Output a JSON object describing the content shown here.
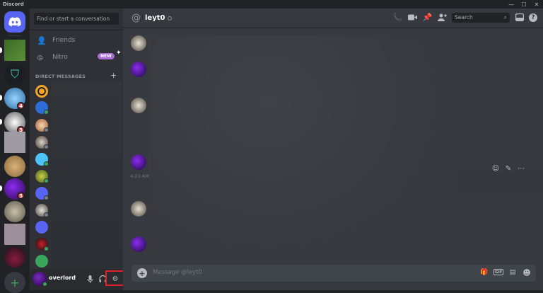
{
  "app": {
    "title": "Discord"
  },
  "window_controls": {
    "minimize": "—",
    "maximize": "☐",
    "close": "✕"
  },
  "guilds": {
    "badges": [
      "4",
      "3",
      "3"
    ],
    "add_glyph": "+"
  },
  "dm_sidebar": {
    "search_placeholder": "Find or start a conversation",
    "friends_label": "Friends",
    "nitro_label": "Nitro",
    "nitro_badge": "NEW",
    "direct_messages_header": "DIRECT MESSAGES",
    "add_dm_glyph": "+"
  },
  "user_panel": {
    "username": "overlord"
  },
  "channel": {
    "name": "leyt0",
    "timestamp": "4:23 AM",
    "search_placeholder": "Search",
    "composer_placeholder": "Message @leyt0"
  },
  "colors": {
    "accent": "#5865f2",
    "highlight": "#e0202b",
    "online": "#3ba55d",
    "badge": "#ed4245"
  },
  "icons": {
    "friends": "friends-icon",
    "nitro": "nitro-icon",
    "mic": "microphone-icon",
    "headphones": "headphones-icon",
    "settings": "gear-icon",
    "call": "phone-call-icon",
    "video": "video-call-icon",
    "pin": "pin-icon",
    "add_member": "add-member-icon",
    "inbox": "inbox-icon",
    "help": "help-icon"
  }
}
